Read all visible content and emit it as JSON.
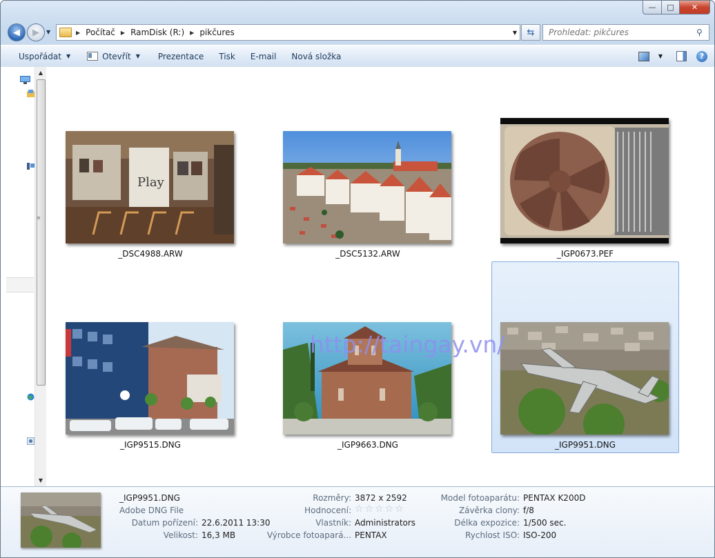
{
  "window": {
    "controls": {
      "minimize": "—",
      "maximize": "□",
      "close": "✕"
    }
  },
  "address": {
    "crumbs": [
      "Počítač",
      "RamDisk (R:)",
      "pikčures"
    ],
    "search_placeholder": "Prohledat: pikčures"
  },
  "toolbar": {
    "organize": "Uspořádat",
    "open": "Otevřít",
    "slideshow": "Prezentace",
    "print": "Tisk",
    "email": "E-mail",
    "new_folder": "Nová složka"
  },
  "files": [
    {
      "name": "_DSC4988.ARW"
    },
    {
      "name": "_DSC5132.ARW"
    },
    {
      "name": "_IGP0673.PEF"
    },
    {
      "name": "_IGP9515.DNG"
    },
    {
      "name": "_IGP9663.DNG"
    },
    {
      "name": "_IGP9951.DNG"
    }
  ],
  "selected_file": "_IGP9951.DNG",
  "watermark": "http://taingay.vn/",
  "details": {
    "name": "_IGP9951.DNG",
    "type": "Adobe DNG File",
    "date_taken_label": "Datum pořízení:",
    "date_taken": "22.6.2011 13:30",
    "size_label": "Velikost:",
    "size": "16,3 MB",
    "dimensions_label": "Rozměry:",
    "dimensions": "3872 x 2592",
    "rating_label": "Hodnocení:",
    "rating": 0,
    "rating_stars": "☆☆☆☆☆",
    "owner_label": "Vlastník:",
    "owner": "Administrators",
    "maker_label": "Výrobce fotoapará...",
    "maker": "PENTAX",
    "model_label": "Model fotoaparátu:",
    "model": "PENTAX K200D",
    "fstop_label": "Závěrka clony:",
    "fstop": "f/8",
    "exposure_label": "Délka expozice:",
    "exposure": "1/500 sec.",
    "iso_label": "Rychlost ISO:",
    "iso": "ISO-200"
  }
}
